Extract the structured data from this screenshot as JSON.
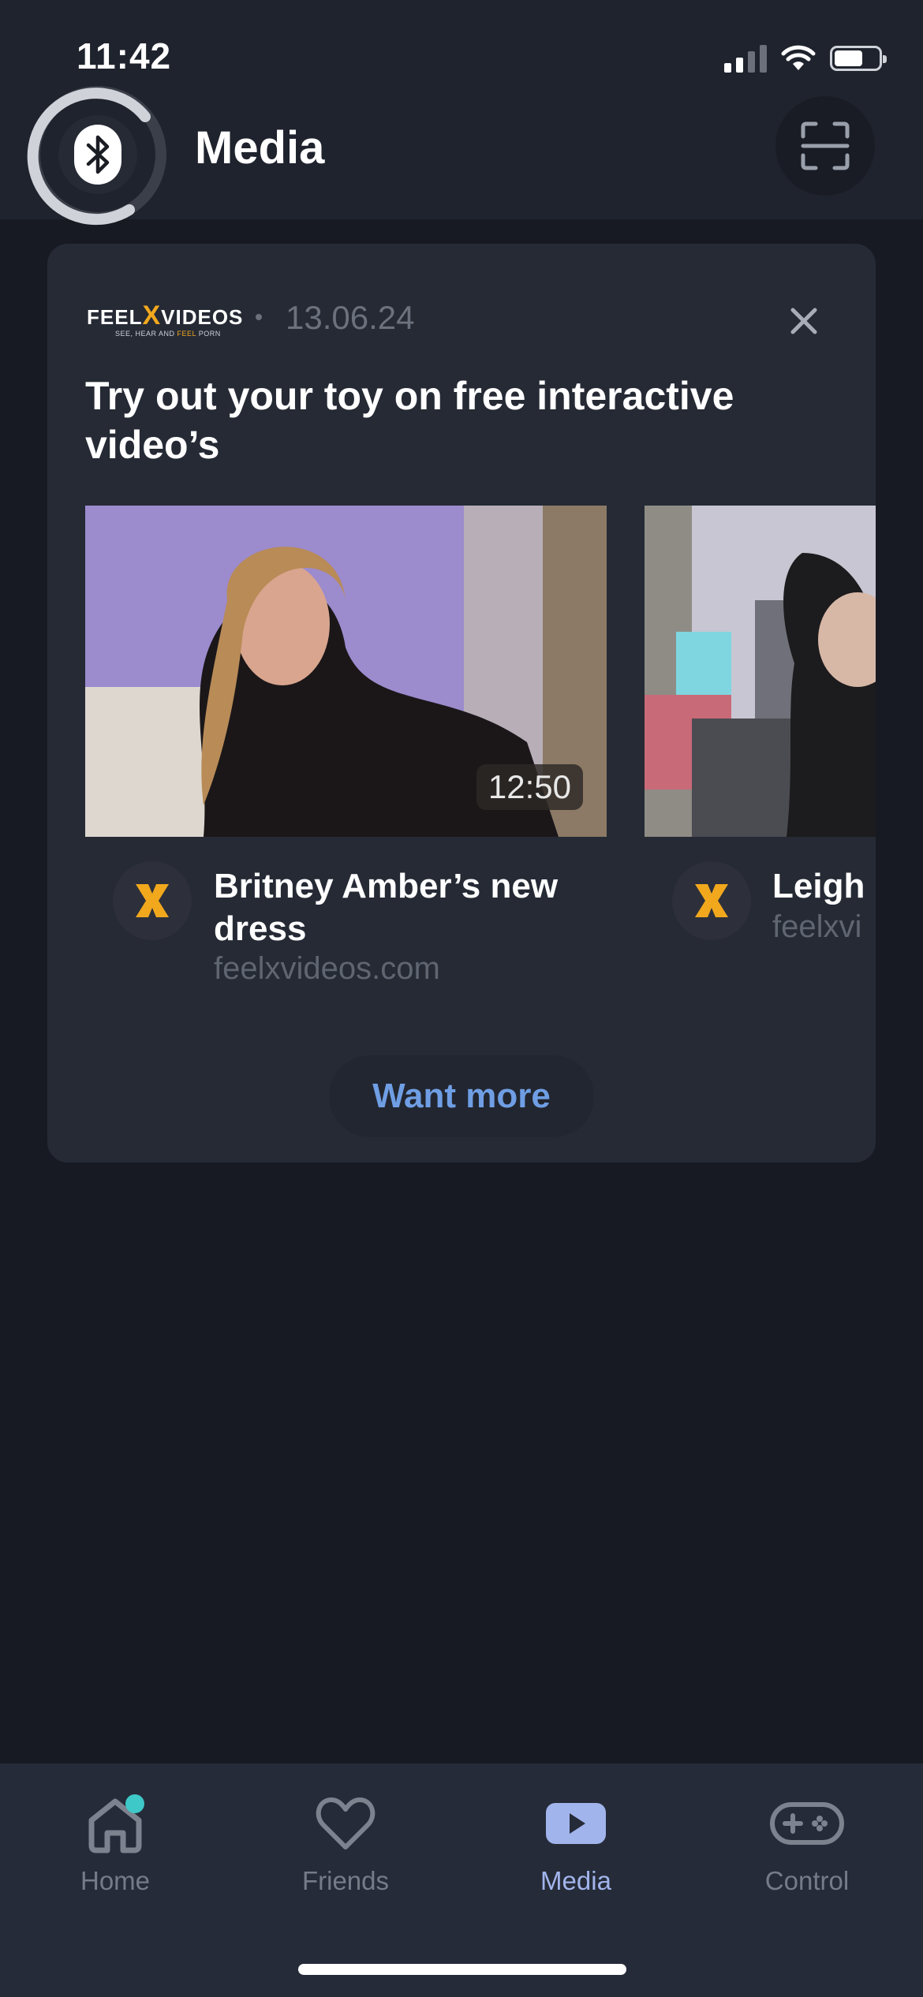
{
  "status_bar": {
    "time": "11:42"
  },
  "header": {
    "title": "Media",
    "bluetooth_icon": "bluetooth-icon",
    "scan_icon": "qr-scan-icon"
  },
  "promo_card": {
    "brand": {
      "name_left": "FEEL",
      "name_x": "X",
      "name_right": "VIDEOS",
      "tagline_a": "SEE, HEAR AND ",
      "tagline_b": "FEEL",
      "tagline_c": " PORN"
    },
    "date": "13.06.24",
    "title": "Try out your toy on free interactive video’s",
    "videos": [
      {
        "duration": "12:50",
        "title": "Britney Amber’s new dress",
        "source": "feelxvideos.com",
        "avatar_letter": "X"
      },
      {
        "title": "Leigh",
        "source": "feelxvi",
        "avatar_letter": "X"
      }
    ],
    "want_more_label": "Want more"
  },
  "tabbar": {
    "tabs": [
      {
        "label": "Home",
        "icon": "home-icon",
        "has_notification": true
      },
      {
        "label": "Friends",
        "icon": "heart-icon"
      },
      {
        "label": "Media",
        "icon": "play-icon",
        "active": true
      },
      {
        "label": "Control",
        "icon": "gamepad-icon"
      }
    ]
  },
  "colors": {
    "background": "#171a22",
    "card": "#252a35",
    "accent_blue": "#6f9ee4",
    "active_tab": "#a2b4ec",
    "brand_orange": "#f2a81d",
    "notification_teal": "#3ec8c8"
  }
}
